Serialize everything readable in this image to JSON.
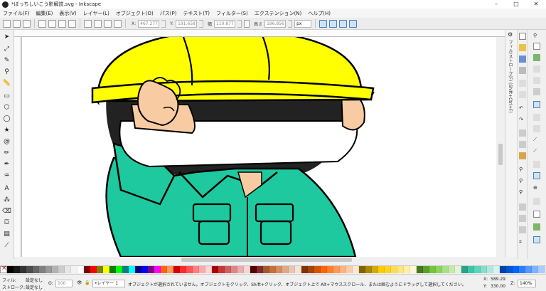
{
  "window": {
    "title": "*ぼっちしいこう影解説.svg - Inkscape",
    "minimize": "–",
    "maximize": "□",
    "close": "✕"
  },
  "menu": [
    "ファイル(F)",
    "編集(E)",
    "表示(V)",
    "レイヤー(L)",
    "オブジェクト(O)",
    "パス(P)",
    "テキスト(T)",
    "フィルター(S)",
    "エクステンション(N)",
    "ヘルプ(H)"
  ],
  "toolcontrols": {
    "x_label": "X:",
    "x_value": "467.277",
    "y_label": "Y:",
    "y_value": "191.658",
    "w_label": "幅",
    "w_value": "110.877",
    "h_label": "高さ",
    "h_value": "196.856",
    "unit": "px"
  },
  "dock": {
    "label": "フィル/ストローク(F) (Shift+Ctrl+F)"
  },
  "palette": {
    "colors": [
      "#000000",
      "#1a1a1a",
      "#333333",
      "#4d4d4d",
      "#666666",
      "#808080",
      "#999999",
      "#b3b3b3",
      "#cccccc",
      "#e6e6e6",
      "#f2f2f2",
      "#ffffff",
      "#800000",
      "#ff0000",
      "#808000",
      "#ffff00",
      "#008000",
      "#00ff00",
      "#008080",
      "#00ffff",
      "#000080",
      "#0000ff",
      "#800080",
      "#ff00ff",
      "#ff6600",
      "#ff9955",
      "#d40000",
      "#ff2a2a",
      "#ff5555",
      "#ff8080",
      "#ffaaaa",
      "#ffd5d5",
      "#aa0000",
      "#c83737",
      "#d35f5f",
      "#de8787",
      "#e9afaf",
      "#f4d7d7",
      "#550000",
      "#802b2b",
      "#a05a2c",
      "#c87137",
      "#d38d5f",
      "#deaa87",
      "#e9c6af",
      "#f4e3d7",
      "#803300",
      "#aa4400",
      "#d45500",
      "#ff6600",
      "#ff7f2a",
      "#ff9955",
      "#ffb380",
      "#ffccaa",
      "#ffe6d5",
      "#806600",
      "#aa8800",
      "#d4aa00",
      "#ffcc00",
      "#ffd42a",
      "#ffdd55",
      "#ffe680",
      "#ffeeaa",
      "#fff6d5",
      "#447821",
      "#5aa02c",
      "#71c837",
      "#8dd35f",
      "#aade87",
      "#c6e9af",
      "#e3f4d7",
      "#2ca089",
      "#37c8ab",
      "#5fd3bc",
      "#87decd",
      "#afe9dd",
      "#d7f4ee",
      "#0044aa",
      "#0055d4",
      "#0066ff",
      "#2a7fff",
      "#5599ff",
      "#80b3ff",
      "#aaccff"
    ]
  },
  "status": {
    "fill_label": "フィル:",
    "fill_value": "設定なし",
    "stroke_label": "ストローク:",
    "stroke_value": "設定なし",
    "opacity_label": "O:",
    "opacity_value": "100",
    "layer": "•レイヤー 1",
    "message": "オブジェクトが選択されていません。オブジェクトをクリック、Shift+クリック、オブジェクト上で Alt+マウススクロール、または囲むようにドラッグして選択してください。",
    "x_label": "X:",
    "x_value": "589.29",
    "y_label": "Y:",
    "y_value": "330.00",
    "z_label": "Z:",
    "z_value": "140%"
  },
  "colors": {
    "helmet": "#ffff00",
    "skin": "#f8cba3",
    "suit": "#1ec9a0",
    "outline": "#000000",
    "hair": "#222222"
  }
}
